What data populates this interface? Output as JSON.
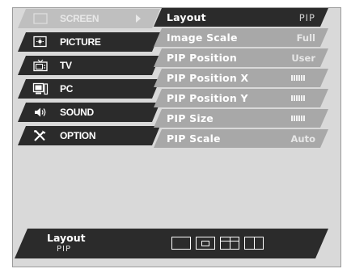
{
  "main_menu": {
    "items": [
      {
        "label": "SCREEN",
        "icon": "screen-icon",
        "active": true
      },
      {
        "label": "PICTURE",
        "icon": "picture-icon"
      },
      {
        "label": "TV",
        "icon": "tv-icon"
      },
      {
        "label": "PC",
        "icon": "pc-icon"
      },
      {
        "label": "SOUND",
        "icon": "sound-icon"
      },
      {
        "label": "OPTION",
        "icon": "option-icon"
      }
    ]
  },
  "sub_menu": {
    "items": [
      {
        "label": "Layout",
        "value": "PIP",
        "selected": true
      },
      {
        "label": "Image Scale",
        "value": "Full"
      },
      {
        "label": "PIP Position",
        "value": "User"
      },
      {
        "label": "PIP Position X",
        "level_icon": "level-bar-icon"
      },
      {
        "label": "PIP Position Y",
        "level_icon": "level-bar-icon"
      },
      {
        "label": "PIP Size",
        "level_icon": "level-bar-icon"
      },
      {
        "label": "PIP Scale",
        "value": "Auto"
      }
    ]
  },
  "help": {
    "title": "Layout",
    "value": "PIP",
    "layout_options": [
      "full-layout-icon",
      "pip-layout-icon",
      "pop-layout-icon",
      "split-layout-icon"
    ]
  },
  "colors": {
    "panel": "#d9d9d9",
    "dark_item": "#2b2b2b",
    "light_item": "#a8a8a8",
    "active_main": "#bfbfbf"
  }
}
